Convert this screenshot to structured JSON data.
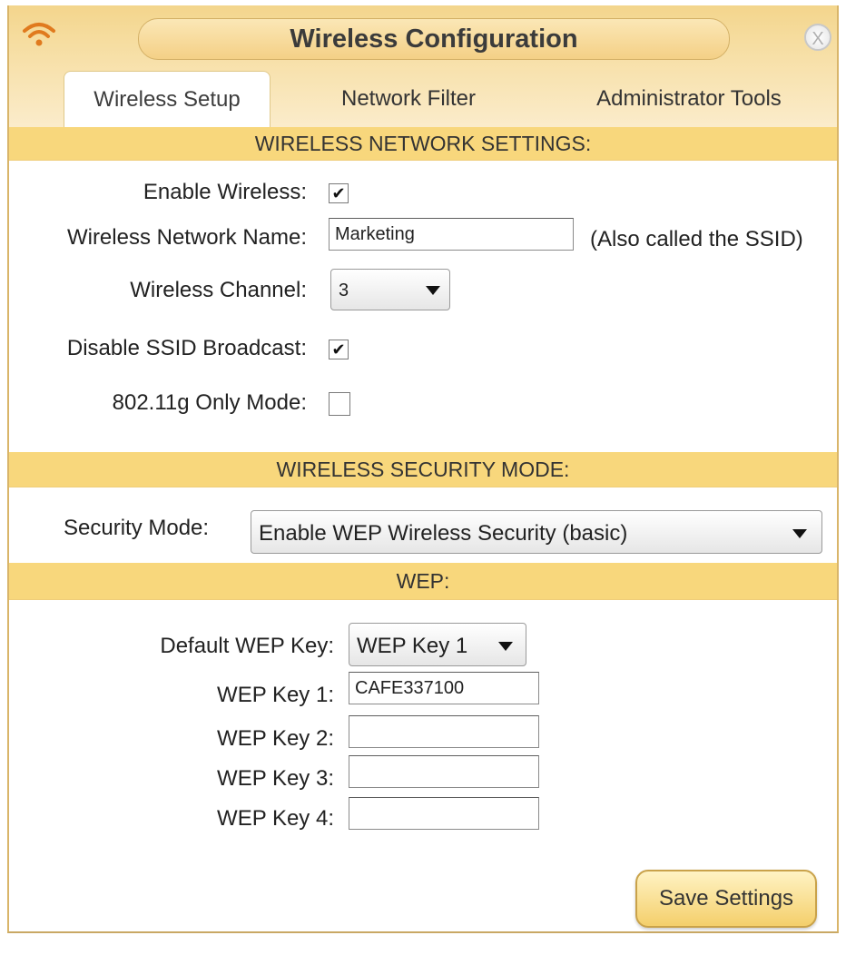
{
  "window": {
    "title": "Wireless Configuration",
    "close_glyph": "X"
  },
  "tabs": [
    {
      "label": "Wireless Setup",
      "active": true
    },
    {
      "label": "Network Filter",
      "active": false
    },
    {
      "label": "Administrator Tools",
      "active": false
    }
  ],
  "wireless_settings": {
    "header": "WIRELESS NETWORK SETTINGS:",
    "enable_wireless": {
      "label": "Enable Wireless:",
      "checked": true
    },
    "network_name": {
      "label": "Wireless Network Name:",
      "value": "Marketing",
      "hint": "(Also called the SSID)"
    },
    "channel": {
      "label": "Wireless Channel:",
      "value": "3"
    },
    "disable_ssid": {
      "label": "Disable SSID Broadcast:",
      "checked": true
    },
    "g_only": {
      "label": "802.11g Only Mode:",
      "checked": false
    }
  },
  "security": {
    "header": "WIRELESS SECURITY MODE:",
    "label": "Security Mode:",
    "value": "Enable WEP Wireless Security (basic)"
  },
  "wep": {
    "header": "WEP:",
    "default_key": {
      "label": "Default WEP Key:",
      "value": "WEP Key 1"
    },
    "keys": [
      {
        "label": "WEP Key 1:",
        "value": "CAFE337100"
      },
      {
        "label": "WEP Key 2:",
        "value": ""
      },
      {
        "label": "WEP Key 3:",
        "value": ""
      },
      {
        "label": "WEP Key 4:",
        "value": ""
      }
    ]
  },
  "actions": {
    "save_label": "Save Settings"
  },
  "colors": {
    "accent": "#f8d77c",
    "titlebar": "#f3d58c",
    "wifi_icon": "#e07a1e"
  },
  "icons": {
    "wifi": "wifi-icon",
    "close": "close-icon",
    "dropdown": "chevron-down-icon"
  }
}
